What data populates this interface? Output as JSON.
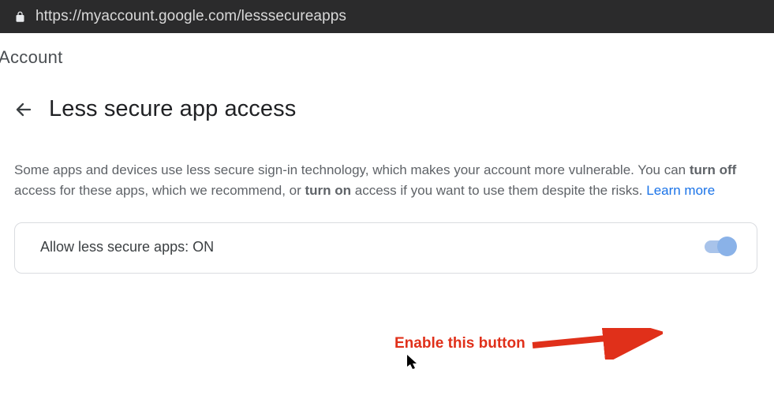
{
  "address_bar": {
    "url": "https://myaccount.google.com/lesssecureapps"
  },
  "breadcrumb": "Account",
  "header": {
    "title": "Less secure app access"
  },
  "description": {
    "part1": "Some apps and devices use less secure sign-in technology, which makes your account more vulnerable. You can ",
    "bold1": "turn off",
    "part2": " access for these apps, which we recommend, or ",
    "bold2": "turn on",
    "part3": " access if you want to use them despite the risks. ",
    "learn_more": "Learn more"
  },
  "setting": {
    "label_prefix": "Allow less secure apps: ",
    "state": "ON"
  },
  "annotation": {
    "text": "Enable this button"
  }
}
